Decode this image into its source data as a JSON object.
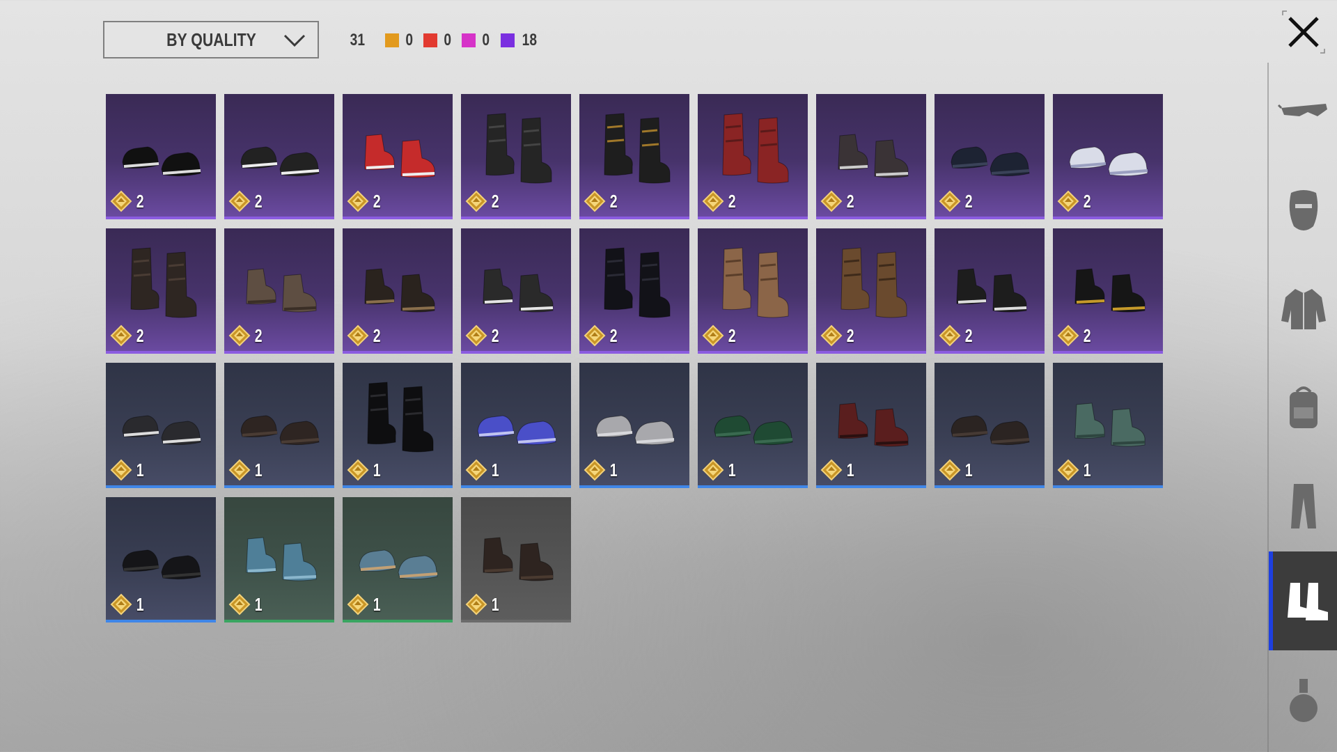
{
  "sort": {
    "label": "BY QUALITY"
  },
  "counts": {
    "total": "31",
    "legendary": {
      "value": "0",
      "color": "#e29a1e"
    },
    "mythic": {
      "value": "0",
      "color": "#e23a30"
    },
    "pink": {
      "value": "0",
      "color": "#d633c8"
    },
    "epic": {
      "value": "18",
      "color": "#7a2fe0"
    }
  },
  "grid": {
    "rows": [
      [
        {
          "quality": "epic",
          "cost": "2",
          "icon": "black-white-loafers-icon",
          "shoe": "#111",
          "accent": "#ddd",
          "style": "low"
        },
        {
          "quality": "epic",
          "cost": "2",
          "icon": "black-sneakers-icon",
          "shoe": "#222",
          "accent": "#eee",
          "style": "low"
        },
        {
          "quality": "epic",
          "cost": "2",
          "icon": "red-boots-icon",
          "shoe": "#c52b2b",
          "accent": "#eee",
          "style": "mid"
        },
        {
          "quality": "epic",
          "cost": "2",
          "icon": "black-combat-boots-icon",
          "shoe": "#252525",
          "accent": "#444",
          "style": "tall"
        },
        {
          "quality": "epic",
          "cost": "2",
          "icon": "laced-military-boots-icon",
          "shoe": "#1e1e1e",
          "accent": "#a0782a",
          "style": "tall"
        },
        {
          "quality": "epic",
          "cost": "2",
          "icon": "red-pirate-boots-icon",
          "shoe": "#8a2424",
          "accent": "#5a1a1a",
          "style": "tall"
        },
        {
          "quality": "epic",
          "cost": "2",
          "icon": "dark-high-tops-icon",
          "shoe": "#3a3336",
          "accent": "#ccc",
          "style": "mid"
        },
        {
          "quality": "epic",
          "cost": "2",
          "icon": "navy-loafers-icon",
          "shoe": "#1d2333",
          "accent": "#3a4258",
          "style": "low"
        },
        {
          "quality": "epic",
          "cost": "2",
          "icon": "white-sandals-icon",
          "shoe": "#d9dce8",
          "accent": "#9a9fc0",
          "style": "low"
        }
      ],
      [
        {
          "quality": "epic",
          "cost": "2",
          "icon": "brown-riding-boots-icon",
          "shoe": "#2e2622",
          "accent": "#4a3c34",
          "style": "tall"
        },
        {
          "quality": "epic",
          "cost": "2",
          "icon": "worn-brown-boots-icon",
          "shoe": "#5e4e42",
          "accent": "#3a2e26",
          "style": "mid"
        },
        {
          "quality": "epic",
          "cost": "2",
          "icon": "fur-lined-boots-icon",
          "shoe": "#2a231e",
          "accent": "#8a6f4c",
          "style": "mid"
        },
        {
          "quality": "epic",
          "cost": "2",
          "icon": "canvas-sneakers-icon",
          "shoe": "#2a2a2a",
          "accent": "#e5e5e5",
          "style": "mid"
        },
        {
          "quality": "epic",
          "cost": "2",
          "icon": "black-tall-boots-icon",
          "shoe": "#121218",
          "accent": "#2a2a35",
          "style": "tall"
        },
        {
          "quality": "epic",
          "cost": "2",
          "icon": "tan-laced-boots-icon",
          "shoe": "#8b6548",
          "accent": "#5a3e2a",
          "style": "tall"
        },
        {
          "quality": "epic",
          "cost": "2",
          "icon": "buckle-boots-icon",
          "shoe": "#6a4a2e",
          "accent": "#3e2a1a",
          "style": "tall"
        },
        {
          "quality": "epic",
          "cost": "2",
          "icon": "black-trainers-icon",
          "shoe": "#1d1d1d",
          "accent": "#ddd",
          "style": "mid"
        },
        {
          "quality": "epic",
          "cost": "2",
          "icon": "black-gold-sneakers-icon",
          "shoe": "#161616",
          "accent": "#c69a2a",
          "style": "mid"
        }
      ],
      [
        {
          "quality": "rare",
          "cost": "1",
          "icon": "gray-sneakers-icon",
          "shoe": "#2a2a2e",
          "accent": "#ddd",
          "style": "low"
        },
        {
          "quality": "rare",
          "cost": "1",
          "icon": "brown-dress-shoes-icon",
          "shoe": "#2e2522",
          "accent": "#4a3c34",
          "style": "low"
        },
        {
          "quality": "rare",
          "cost": "1",
          "icon": "black-knee-boots-icon",
          "shoe": "#0e0e10",
          "accent": "#2a2a2e",
          "style": "tall"
        },
        {
          "quality": "rare",
          "cost": "1",
          "icon": "blue-velcro-sneakers-icon",
          "shoe": "#4a4fc8",
          "accent": "#c0c4f0",
          "style": "low"
        },
        {
          "quality": "rare",
          "cost": "1",
          "icon": "gray-slip-ons-icon",
          "shoe": "#a8a8ac",
          "accent": "#d8d8dc",
          "style": "low"
        },
        {
          "quality": "rare",
          "cost": "1",
          "icon": "green-sneakers-icon",
          "shoe": "#1f4a33",
          "accent": "#3a6a50",
          "style": "low"
        },
        {
          "quality": "rare",
          "cost": "1",
          "icon": "maroon-boots-icon",
          "shoe": "#5a1e1e",
          "accent": "#2a1010",
          "style": "mid"
        },
        {
          "quality": "rare",
          "cost": "1",
          "icon": "dark-brown-shoes-icon",
          "shoe": "#2b2422",
          "accent": "#463a34",
          "style": "low"
        },
        {
          "quality": "rare",
          "cost": "1",
          "icon": "teal-chelsea-boots-icon",
          "shoe": "#4a6a62",
          "accent": "#2e4640",
          "style": "mid"
        }
      ],
      [
        {
          "quality": "rare",
          "cost": "1",
          "icon": "black-oxfords-icon",
          "shoe": "#151518",
          "accent": "#333",
          "style": "low"
        },
        {
          "quality": "uncommon",
          "cost": "1",
          "icon": "blue-high-tops-icon",
          "shoe": "#4f7f98",
          "accent": "#8ab6cc",
          "style": "mid"
        },
        {
          "quality": "uncommon",
          "cost": "1",
          "icon": "blue-low-sneakers-icon",
          "shoe": "#5a7e94",
          "accent": "#c2a074",
          "style": "low"
        },
        {
          "quality": "common",
          "cost": "1",
          "icon": "brown-work-boots-icon",
          "shoe": "#2e2420",
          "accent": "#4a3a30",
          "style": "mid"
        }
      ]
    ]
  },
  "sidebar": {
    "tabs": [
      {
        "name": "eyewear",
        "icon": "glasses-icon"
      },
      {
        "name": "mask",
        "icon": "mask-icon"
      },
      {
        "name": "outfit",
        "icon": "jacket-icon"
      },
      {
        "name": "backpack",
        "icon": "backpack-icon"
      },
      {
        "name": "pants",
        "icon": "pants-icon"
      },
      {
        "name": "shoes",
        "icon": "boots-icon",
        "active": true
      },
      {
        "name": "grenade",
        "icon": "grenade-icon"
      }
    ]
  }
}
